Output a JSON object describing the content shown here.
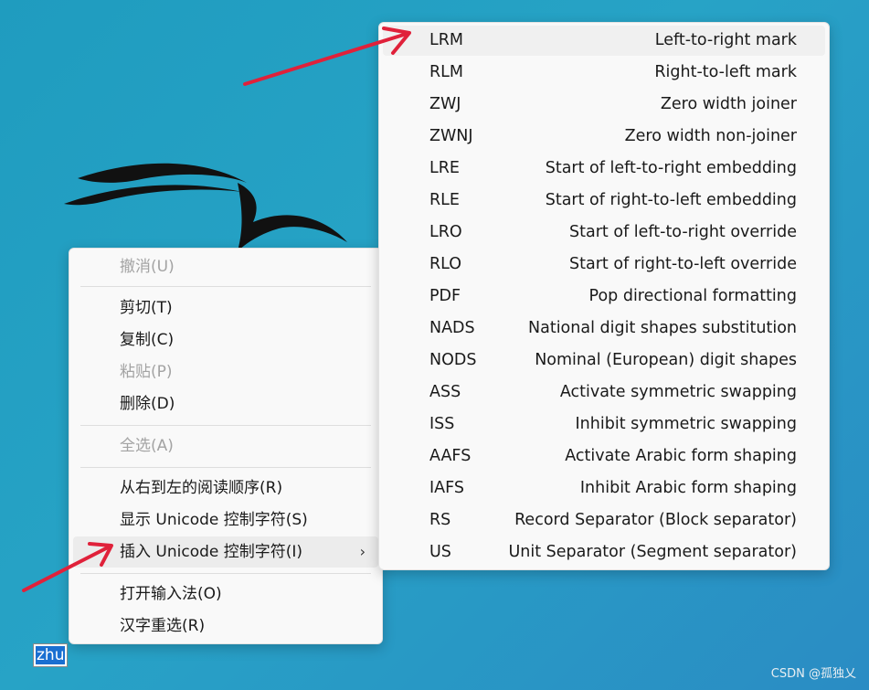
{
  "context_menu": {
    "items": [
      {
        "label": "撤消(U)",
        "disabled": true
      },
      {
        "label": "剪切(T)",
        "disabled": false
      },
      {
        "label": "复制(C)",
        "disabled": false
      },
      {
        "label": "粘贴(P)",
        "disabled": true
      },
      {
        "label": "删除(D)",
        "disabled": false
      },
      {
        "label": "全选(A)",
        "disabled": true
      },
      {
        "label": "从右到左的阅读顺序(R)",
        "disabled": false
      },
      {
        "label": "显示 Unicode 控制字符(S)",
        "disabled": false
      },
      {
        "label": "插入 Unicode 控制字符(I)",
        "disabled": false,
        "submenu_icon": "chevron-right-icon"
      },
      {
        "label": "打开输入法(O)",
        "disabled": false
      },
      {
        "label": "汉字重选(R)",
        "disabled": false
      }
    ]
  },
  "submenu": {
    "items": [
      {
        "abbr": "LRM",
        "desc": "Left-to-right mark"
      },
      {
        "abbr": "RLM",
        "desc": "Right-to-left mark"
      },
      {
        "abbr": "ZWJ",
        "desc": "Zero width joiner"
      },
      {
        "abbr": "ZWNJ",
        "desc": "Zero width non-joiner"
      },
      {
        "abbr": "LRE",
        "desc": "Start of left-to-right embedding"
      },
      {
        "abbr": "RLE",
        "desc": "Start of right-to-left embedding"
      },
      {
        "abbr": "LRO",
        "desc": "Start of left-to-right override"
      },
      {
        "abbr": "RLO",
        "desc": "Start of right-to-left override"
      },
      {
        "abbr": "PDF",
        "desc": "Pop directional formatting"
      },
      {
        "abbr": "NADS",
        "desc": "National digit shapes substitution"
      },
      {
        "abbr": "NODS",
        "desc": "Nominal (European) digit shapes"
      },
      {
        "abbr": "ASS",
        "desc": "Activate symmetric swapping"
      },
      {
        "abbr": "ISS",
        "desc": "Inhibit symmetric swapping"
      },
      {
        "abbr": "AAFS",
        "desc": "Activate Arabic form shaping"
      },
      {
        "abbr": "IAFS",
        "desc": "Inhibit Arabic form shaping"
      },
      {
        "abbr": "RS",
        "desc": "Record Separator (Block separator)"
      },
      {
        "abbr": "US",
        "desc": "Unit Separator (Segment separator)"
      }
    ]
  },
  "ime": {
    "composition": "zhu"
  },
  "watermark": "CSDN @孤独乂",
  "colors": {
    "arrow": "#e0213a",
    "selection": "#1a6fd1",
    "background": "#27a3c6"
  }
}
